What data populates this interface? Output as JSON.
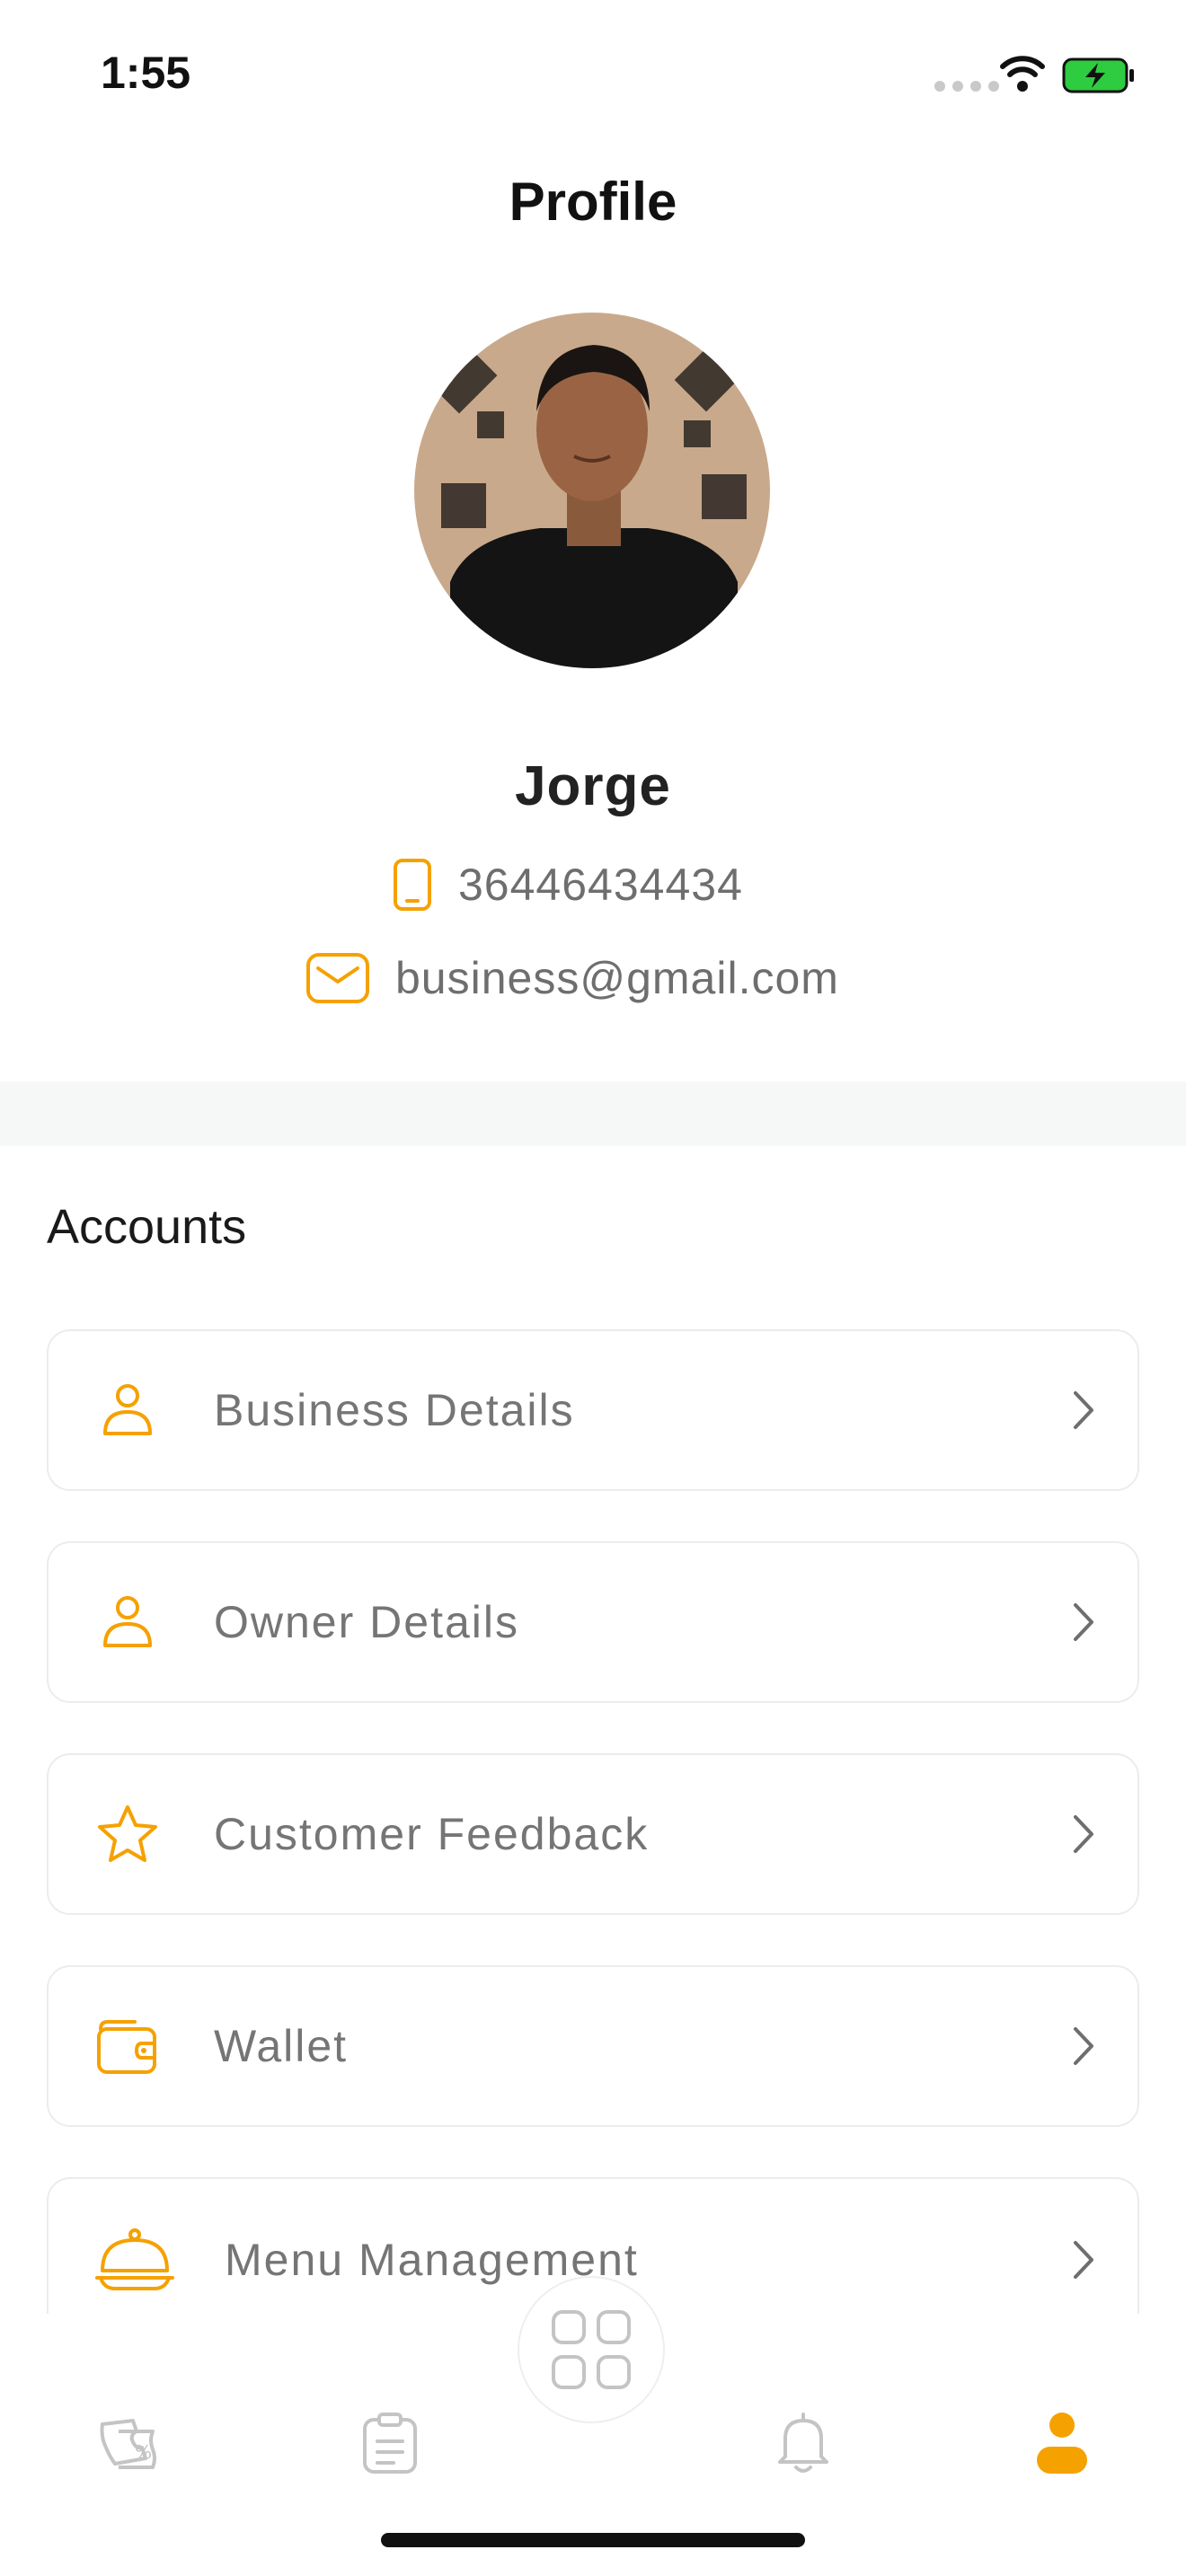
{
  "status_bar": {
    "time": "1:55"
  },
  "header": {
    "title": "Profile"
  },
  "profile": {
    "name": "Jorge",
    "phone": "36446434434",
    "email": "business@gmail.com"
  },
  "accounts": {
    "title": "Accounts",
    "items": [
      {
        "label": "Business Details",
        "icon": "user-icon"
      },
      {
        "label": "Owner Details",
        "icon": "user-icon"
      },
      {
        "label": "Customer Feedback",
        "icon": "star-icon"
      },
      {
        "label": "Wallet",
        "icon": "wallet-icon"
      },
      {
        "label": "Menu Management",
        "icon": "cloche-icon"
      }
    ]
  },
  "bottom_nav": {
    "items": [
      "offers-icon",
      "orders-icon",
      "dashboard-icon",
      "notifications-icon",
      "profile-icon"
    ],
    "active": "profile-icon"
  },
  "colors": {
    "accent": "#F5A100",
    "muted_icon": "#c4c4c4"
  }
}
